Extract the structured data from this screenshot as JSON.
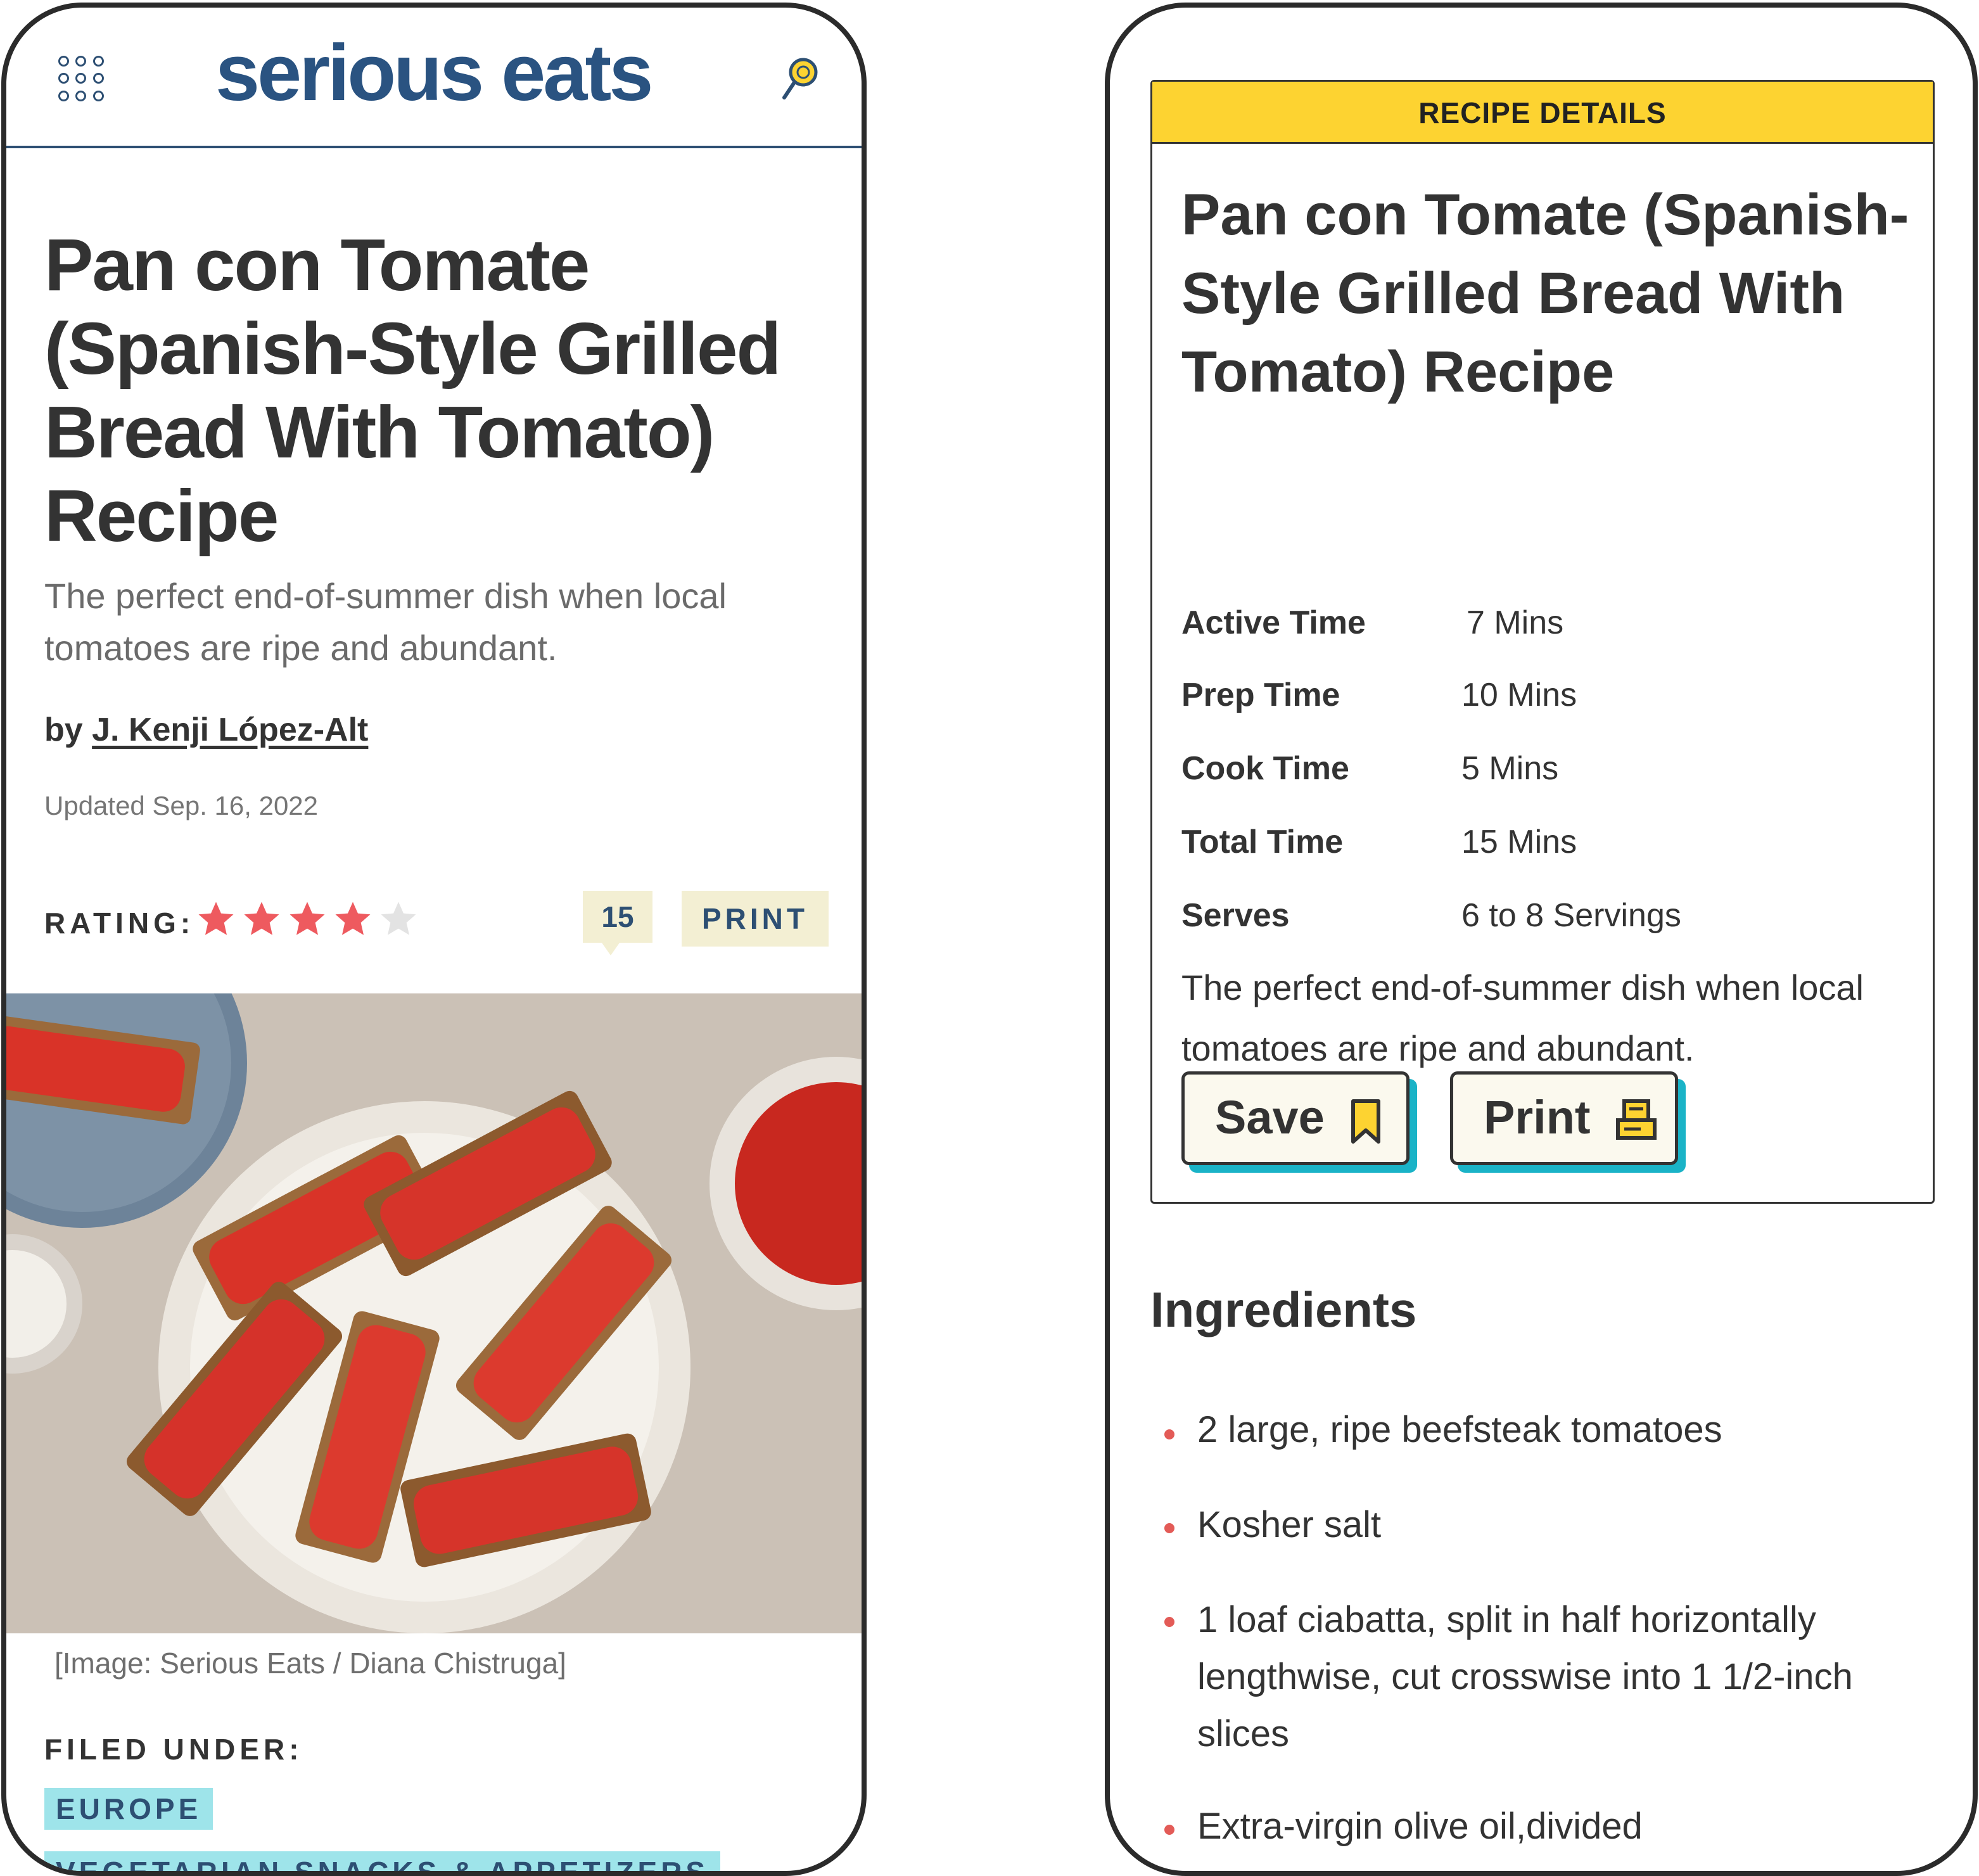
{
  "colors": {
    "brand_blue": "#2a5381",
    "star_red": "#ee5a5f",
    "star_empty": "#e3e3e3",
    "badge_cream": "#f3efd3",
    "tag_teal": "#9ee4ea",
    "card_yellow": "#fdd331",
    "button_shadow_teal": "#1ab3c7",
    "bullet_red": "#e35b57"
  },
  "left_screen": {
    "header": {
      "menu_icon": "grid-menu-icon",
      "logo": "serious eats",
      "search_icon": "search-icon"
    },
    "article": {
      "title": "Pan con Tomate (Spanish-Style Grilled Bread With Tomato) Recipe",
      "dek": "The perfect end-of-summer dish when local tomatoes are ripe and abundant.",
      "byline_prefix": "by ",
      "author": "J. Kenji López-Alt",
      "updated": "Updated Sep. 16, 2022"
    },
    "rating": {
      "label": "RATING:",
      "stars_filled": 4,
      "stars_total": 5,
      "comment_count": "15",
      "print_label": "PRINT"
    },
    "image": {
      "caption": "[Image: Serious Eats / Diana Chistruga]"
    },
    "filed_under": {
      "label": "FILED UNDER:",
      "tags": [
        "EUROPE",
        "VEGETARIAN SNACKS & APPETIZERS"
      ]
    }
  },
  "right_screen": {
    "card": {
      "header": "RECIPE DETAILS",
      "title": "Pan con Tomate (Spanish-Style Grilled Bread With Tomato) Recipe",
      "meta": [
        {
          "label": "Active Time",
          "value": "7 Mins"
        },
        {
          "label": "Prep Time",
          "value": "10 Mins"
        },
        {
          "label": "Cook Time",
          "value": "5 Mins"
        },
        {
          "label": "Total Time",
          "value": "15 Mins"
        },
        {
          "label": "Serves",
          "value": "6 to 8 Servings"
        }
      ],
      "description": "The perfect end-of-summer dish when local tomatoes are ripe and abundant.",
      "save_label": "Save",
      "save_icon": "bookmark-icon",
      "print_label": "Print",
      "print_icon": "printer-icon"
    },
    "ingredients": {
      "title": "Ingredients",
      "items": [
        "2 large, ripe beefsteak tomatoes",
        "Kosher salt",
        "1 loaf ciabatta, split in half horizontally lengthwise, cut crosswise into 1 1/2-inch slices",
        "Extra-virgin olive oil,divided"
      ]
    }
  }
}
